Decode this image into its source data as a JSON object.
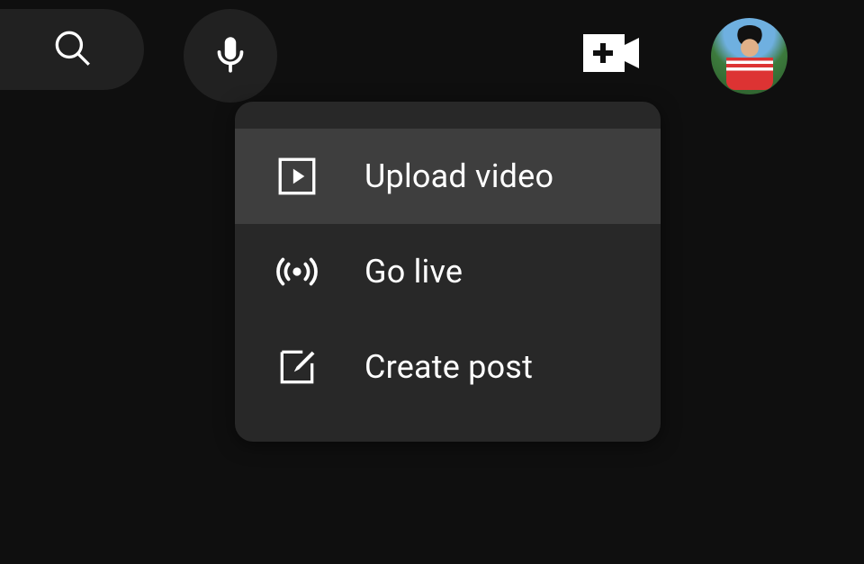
{
  "menu": {
    "items": [
      {
        "label": "Upload video",
        "icon": "play-box-icon",
        "highlighted": true
      },
      {
        "label": "Go live",
        "icon": "live-broadcast-icon",
        "highlighted": false
      },
      {
        "label": "Create post",
        "icon": "compose-icon",
        "highlighted": false
      }
    ]
  },
  "topbar": {
    "search_icon": "search-icon",
    "mic_icon": "mic-icon",
    "create_icon": "camera-plus-icon",
    "avatar": "user-avatar"
  }
}
